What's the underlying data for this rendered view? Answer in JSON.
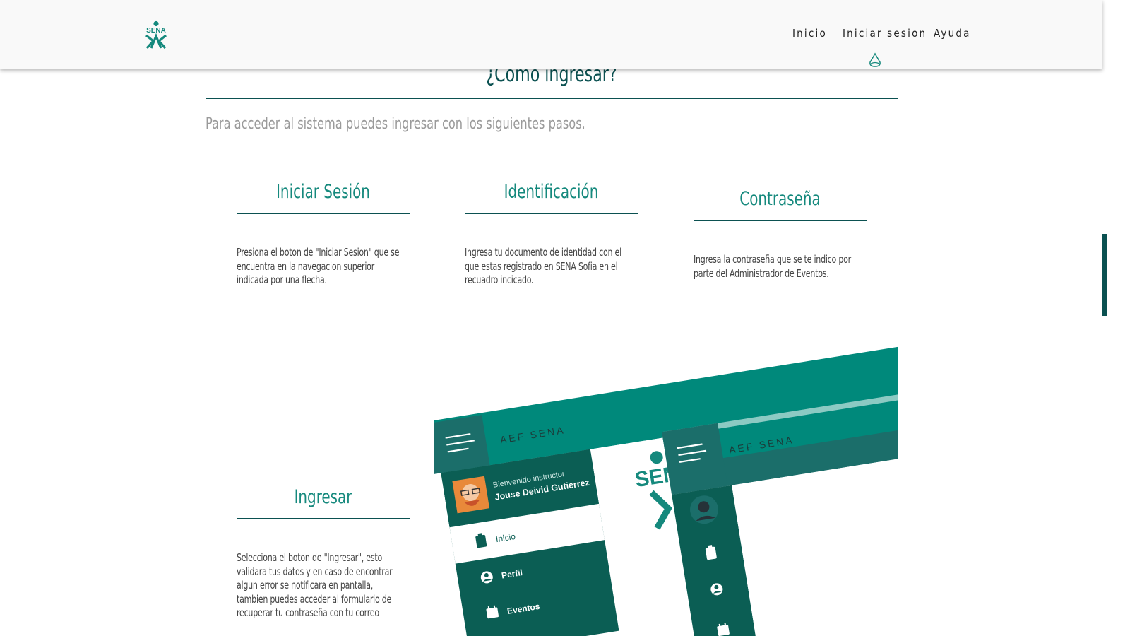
{
  "navbar": {
    "logo_text": "SENA",
    "links": [
      "Inicio",
      "Iniciar sesion",
      "Ayuda"
    ]
  },
  "main": {
    "title": "¿Como ingresar?",
    "intro": "Para acceder al sistema puedes ingresar con los siguientes pasos.",
    "steps": [
      {
        "title": "Iniciar Sesión",
        "text": "Presiona el boton de \"Iniciar Sesion\" que se encuentra en la navegacion superior indicada por una flecha."
      },
      {
        "title": "Identificación",
        "text": "Ingresa tu documento de identidad con el que estas registrado en SENA Sofia en el recuadro incicado."
      },
      {
        "title": "Contraseña",
        "text": "Ingresa la contraseña que se te indico por parte del Administrador de Eventos."
      },
      {
        "title": "Ingresar",
        "text": "Selecciona el boton de \"Ingresar\", esto validara tus datos y en caso de encontrar algun error se notificara en pantalla, tambien puedes acceder al formulario de recuperar tu contraseña con tu correo"
      }
    ]
  },
  "preview": {
    "app_title": "AEF SENA",
    "welcome": "Bienvenido instructor",
    "user_name": "Jouse Deivid Gutierrez",
    "menu": [
      "Inicio",
      "Perfil",
      "Eventos"
    ],
    "logo_text": "SENA"
  },
  "colors": {
    "primary_dark": "#0b5151",
    "accent": "#15897d",
    "header_green": "#00897b",
    "sidebar_dark": "#0b5e54"
  }
}
